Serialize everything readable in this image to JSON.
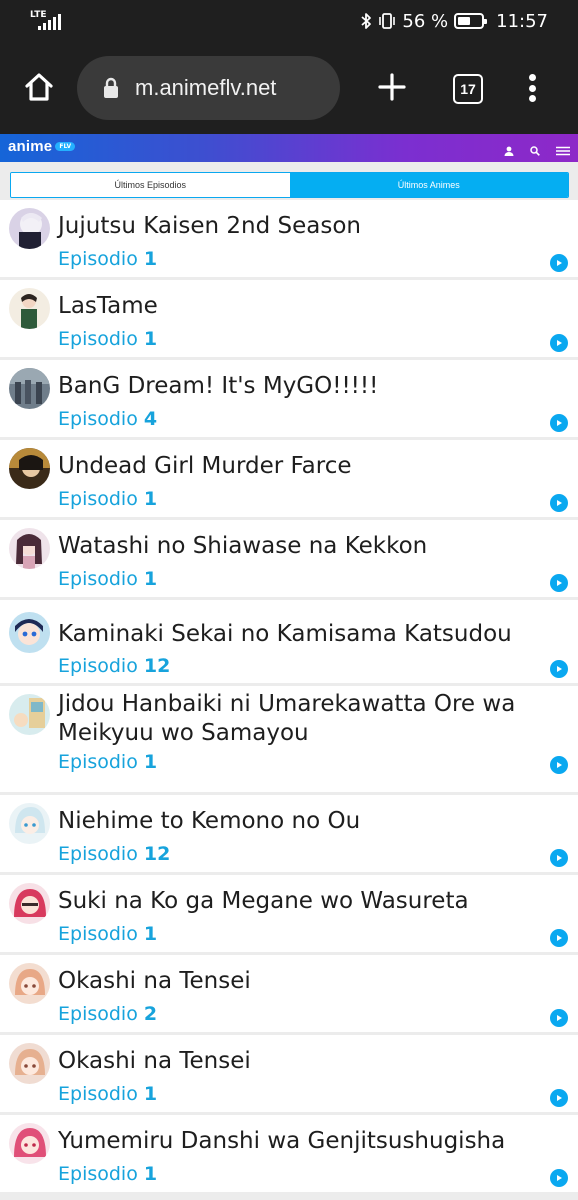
{
  "status_bar": {
    "network": "LTE",
    "battery_percent": "56 %",
    "battery_level": 0.56,
    "time": "11:57"
  },
  "browser": {
    "url": "m.animeflv.net",
    "tab_count": "17"
  },
  "site": {
    "logo_text": "anime",
    "logo_badge": "FLV",
    "brand_colors": [
      "#1565d8",
      "#8e28c8"
    ],
    "accent": "#05aef2"
  },
  "tabs": [
    {
      "label": "Últimos Episodios",
      "active": true
    },
    {
      "label": "Últimos Animes",
      "active": false
    }
  ],
  "episodes": [
    {
      "title": "Jujutsu Kaisen 2nd Season",
      "ep_label": "Episodio",
      "ep_number": "1"
    },
    {
      "title": "LasTame",
      "ep_label": "Episodio",
      "ep_number": "1"
    },
    {
      "title": "BanG Dream! It's MyGO!!!!!",
      "ep_label": "Episodio",
      "ep_number": "4"
    },
    {
      "title": "Undead Girl Murder Farce",
      "ep_label": "Episodio",
      "ep_number": "1"
    },
    {
      "title": "Watashi no Shiawase na Kekkon",
      "ep_label": "Episodio",
      "ep_number": "1"
    },
    {
      "title": "Kaminaki Sekai no Kamisama Katsudou",
      "ep_label": "Episodio",
      "ep_number": "12"
    },
    {
      "title": "Jidou Hanbaiki ni Umarekawatta Ore wa Meikyuu wo Samayou",
      "ep_label": "Episodio",
      "ep_number": "1"
    },
    {
      "title": "Niehime to Kemono no Ou",
      "ep_label": "Episodio",
      "ep_number": "12"
    },
    {
      "title": "Suki na Ko ga Megane wo Wasureta",
      "ep_label": "Episodio",
      "ep_number": "1"
    },
    {
      "title": "Okashi na Tensei",
      "ep_label": "Episodio",
      "ep_number": "2"
    },
    {
      "title": "Okashi na Tensei",
      "ep_label": "Episodio",
      "ep_number": "1"
    },
    {
      "title": "Yumemiru Danshi wa Genjitsushugisha",
      "ep_label": "Episodio",
      "ep_number": "1"
    }
  ]
}
